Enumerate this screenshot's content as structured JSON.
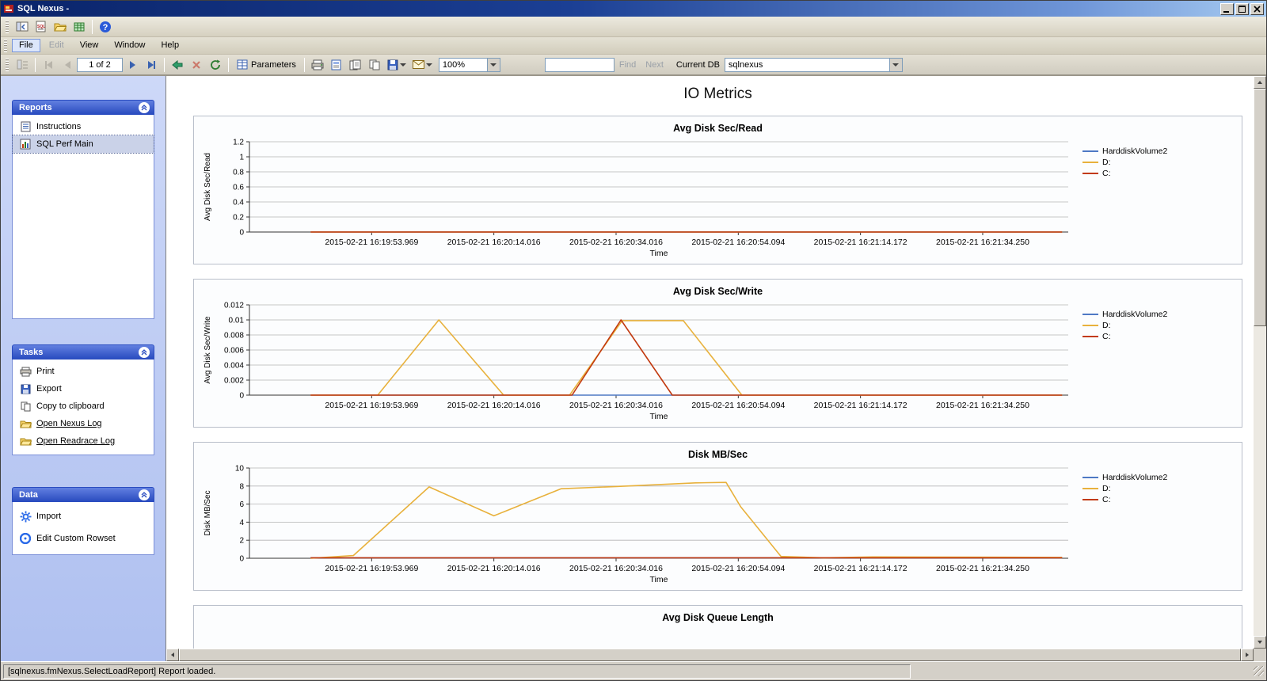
{
  "window": {
    "title": "SQL Nexus -"
  },
  "menu": {
    "items": [
      "File",
      "Edit",
      "View",
      "Window",
      "Help"
    ]
  },
  "reportbar": {
    "page": "1 of 2",
    "parameters_label": "Parameters",
    "zoom": "100%",
    "find_label": "Find",
    "next_label": "Next",
    "current_db_label": "Current DB",
    "db_value": "sqlnexus"
  },
  "sidebar": {
    "reports": {
      "title": "Reports",
      "items": [
        "Instructions",
        "SQL Perf Main"
      ]
    },
    "tasks": {
      "title": "Tasks",
      "items": [
        "Print",
        "Export",
        "Copy to clipboard",
        "Open Nexus Log",
        "Open Readrace Log"
      ]
    },
    "data_panel": {
      "title": "Data",
      "items": [
        "Import",
        "Edit Custom Rowset"
      ]
    }
  },
  "report": {
    "title": "IO Metrics"
  },
  "status": {
    "text": "[sqlnexus.fmNexus.SelectLoadReport] Report loaded."
  },
  "chart_data": [
    {
      "type": "line",
      "title": "Avg Disk Sec/Read",
      "ylabel": "Avg Disk Sec/Read",
      "xlabel": "Time",
      "ylim": [
        0,
        1.2
      ],
      "yticks": [
        0,
        0.2,
        0.4,
        0.6,
        0.8,
        1,
        1.2
      ],
      "x_domain": [
        0,
        6.7
      ],
      "grid": true,
      "legend_position": "right",
      "categories": [
        "2015-02-21 16:19:53.969",
        "2015-02-21 16:20:14.016",
        "2015-02-21 16:20:34.016",
        "2015-02-21 16:20:54.094",
        "2015-02-21 16:21:14.172",
        "2015-02-21 16:21:34.250"
      ],
      "series": [
        {
          "name": "HarddiskVolume2",
          "color": "#4e79c4",
          "points": [
            [
              0.5,
              0
            ],
            [
              6.65,
              0
            ]
          ]
        },
        {
          "name": "D:",
          "color": "#e8b13c",
          "points": [
            [
              0.5,
              0
            ],
            [
              6.65,
              0
            ]
          ]
        },
        {
          "name": "C:",
          "color": "#c23a10",
          "points": [
            [
              0.5,
              0
            ],
            [
              6.65,
              0
            ]
          ]
        }
      ]
    },
    {
      "type": "line",
      "title": "Avg Disk Sec/Write",
      "ylabel": "Avg Disk Sec/Write",
      "xlabel": "Time",
      "ylim": [
        0,
        0.012
      ],
      "yticks": [
        0,
        0.002,
        0.004,
        0.006,
        0.008,
        0.01,
        0.012
      ],
      "x_domain": [
        0,
        6.7
      ],
      "grid": true,
      "legend_position": "right",
      "categories": [
        "2015-02-21 16:19:53.969",
        "2015-02-21 16:20:14.016",
        "2015-02-21 16:20:34.016",
        "2015-02-21 16:20:54.094",
        "2015-02-21 16:21:14.172",
        "2015-02-21 16:21:34.250"
      ],
      "series": [
        {
          "name": "HarddiskVolume2",
          "color": "#4e79c4",
          "points": [
            [
              0.5,
              0
            ],
            [
              6.65,
              0
            ]
          ]
        },
        {
          "name": "D:",
          "color": "#e8b13c",
          "points": [
            [
              0.5,
              0
            ],
            [
              1.05,
              0
            ],
            [
              1.55,
              0.01
            ],
            [
              2.08,
              0
            ],
            [
              2.62,
              0
            ],
            [
              3.05,
              0.0099
            ],
            [
              3.55,
              0.0099
            ],
            [
              4.03,
              0
            ],
            [
              6.65,
              0
            ]
          ]
        },
        {
          "name": "C:",
          "color": "#c23a10",
          "points": [
            [
              0.5,
              0
            ],
            [
              2.64,
              0
            ],
            [
              3.04,
              0.01
            ],
            [
              3.46,
              0
            ],
            [
              6.65,
              0
            ]
          ]
        }
      ]
    },
    {
      "type": "line",
      "title": "Disk MB/Sec",
      "ylabel": "Disk MB/Sec",
      "xlabel": "Time",
      "ylim": [
        0,
        10
      ],
      "yticks": [
        0,
        2,
        4,
        6,
        8,
        10
      ],
      "x_domain": [
        0,
        6.7
      ],
      "grid": true,
      "legend_position": "right",
      "categories": [
        "2015-02-21 16:19:53.969",
        "2015-02-21 16:20:14.016",
        "2015-02-21 16:20:34.016",
        "2015-02-21 16:20:54.094",
        "2015-02-21 16:21:14.172",
        "2015-02-21 16:21:34.250"
      ],
      "series": [
        {
          "name": "HarddiskVolume2",
          "color": "#4e79c4",
          "points": [
            [
              0.5,
              0.05
            ],
            [
              6.65,
              0.05
            ]
          ]
        },
        {
          "name": "D:",
          "color": "#e8b13c",
          "points": [
            [
              0.5,
              0
            ],
            [
              0.85,
              0.3
            ],
            [
              1.47,
              7.9
            ],
            [
              2.0,
              4.7
            ],
            [
              2.55,
              7.7
            ],
            [
              3.0,
              7.95
            ],
            [
              3.65,
              8.35
            ],
            [
              3.9,
              8.4
            ],
            [
              4.02,
              5.7
            ],
            [
              4.35,
              0.2
            ],
            [
              4.7,
              0.05
            ],
            [
              5.1,
              0.15
            ],
            [
              6.65,
              0.1
            ]
          ]
        },
        {
          "name": "C:",
          "color": "#c23a10",
          "points": [
            [
              0.5,
              0.05
            ],
            [
              6.65,
              0.05
            ]
          ]
        }
      ]
    },
    {
      "type": "line",
      "title": "Avg Disk Queue Length",
      "partial": true
    }
  ]
}
